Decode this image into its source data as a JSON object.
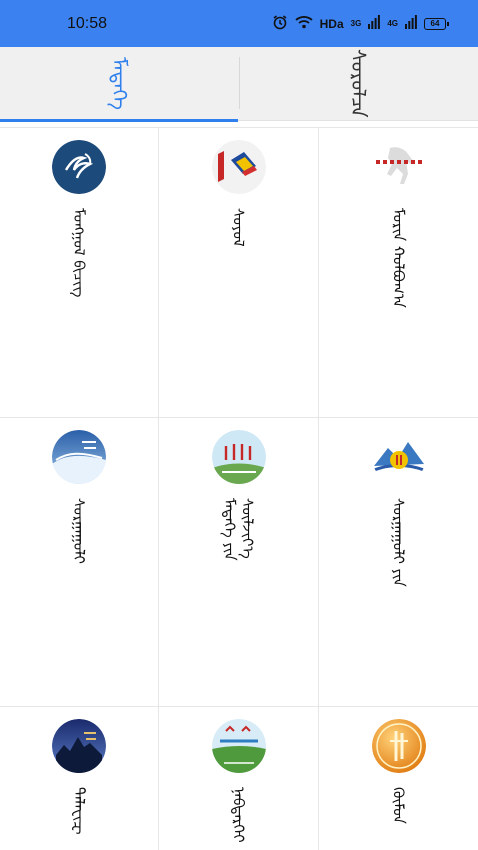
{
  "status_bar": {
    "time": "10:58",
    "network_1": "3G",
    "network_2": "4G",
    "hd_label": "HDa",
    "battery": "64",
    "icons": [
      "alarm-icon",
      "wifi-icon",
      "signal-icon",
      "signal-icon",
      "battery-icon"
    ]
  },
  "tabs": [
    {
      "label": "ᠮᠡᠳᠡᠭᠡ",
      "active": true
    },
    {
      "label": "ᠰᠤᠷᠤᠯᠴᠠ",
      "active": false
    }
  ],
  "accent_color": "#2f80ed",
  "status_bar_color": "#3b82f0",
  "grid_items": [
    {
      "label": "ᠮᠣᠩᠭᠣᠯ ᠪᠢᠴᠢᠭ",
      "icon": "calligraphy-logo-icon"
    },
    {
      "label": "ᠰᠣᠶᠣᠯ",
      "icon": "book-logo-icon"
    },
    {
      "label": "ᠮᠣᠷᠢᠨ ᠬᠣᠯᠪᠣᠭ᠎ᠠ",
      "icon": "horse-logo-icon"
    },
    {
      "label": "ᠰᠤᠷᠭᠠᠭᠤᠯᠢ",
      "icon": "wave-logo-icon"
    },
    {
      "label": "ᠮᠡᠳᠡᠭᠡ ᠶᠢᠨ ᠰᠦᠯᠵᠢᠶ᠎ᠡ",
      "icon": "grassland-logo-icon"
    },
    {
      "label": "ᠰᠤᠷᠭᠠᠭᠤᠯᠢ ᠶᠢᠨ",
      "icon": "mountain-logo-icon"
    },
    {
      "label": "ᠲᠡᠯᠡᠸᠢᠽ",
      "icon": "night-city-logo-icon"
    },
    {
      "label": "ᠨᠡᠪᠲᠡᠷᠬᠡᠢ",
      "icon": "steppe-logo-icon"
    },
    {
      "label": "ᠬᠥᠮᠦᠨ",
      "icon": "gold-coin-logo-icon"
    }
  ]
}
